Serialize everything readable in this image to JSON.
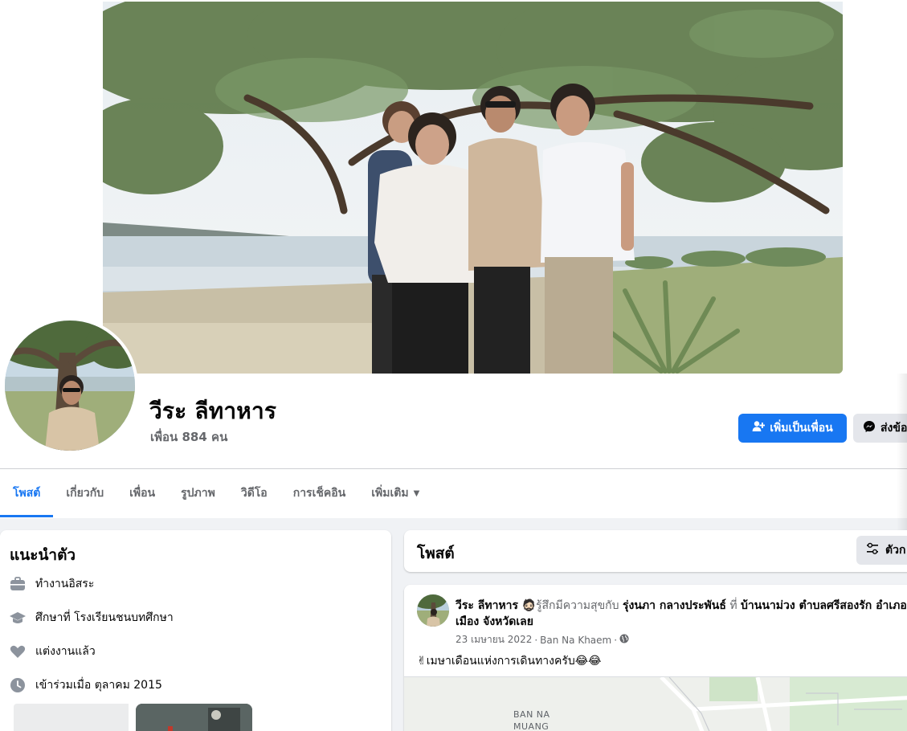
{
  "profile": {
    "name": "วีระ ลีทาหาร",
    "friends_label": "เพื่อน 884 คน"
  },
  "actions": {
    "add_friend_label": "เพิ่มเป็นเพื่อน",
    "message_label": "ส่งข้อ"
  },
  "tabs": [
    {
      "label": "โพสต์",
      "active": true
    },
    {
      "label": "เกี่ยวกับ",
      "active": false
    },
    {
      "label": "เพื่อน",
      "active": false
    },
    {
      "label": "รูปภาพ",
      "active": false
    },
    {
      "label": "วิดีโอ",
      "active": false
    },
    {
      "label": "การเช็คอิน",
      "active": false
    },
    {
      "label": "เพิ่มเติม",
      "active": false
    }
  ],
  "intro": {
    "title": "แนะนำตัว",
    "items": [
      {
        "icon": "briefcase-icon",
        "text": "ทำงานอิสระ"
      },
      {
        "icon": "graduation-cap-icon",
        "text": "ศึกษาที่ โรงเรียนชนบทศึกษา"
      },
      {
        "icon": "heart-icon",
        "text": "แต่งงานแล้ว"
      },
      {
        "icon": "clock-icon",
        "text": "เข้าร่วมเมื่อ ตุลาคม 2015"
      }
    ]
  },
  "posts": {
    "title": "โพสต์",
    "filter_label": "ตัวก"
  },
  "post": {
    "author": "วีระ ลีทาหาร",
    "feeling_text": "รู้สึกมีความสุขกับ",
    "tagged": "รุ่งนภา กลางประพันธ์",
    "at_word": "ที่",
    "place": "บ้านนาม่วง ตำบลศรีสองรัก อำเภอเมือง จังหวัดเลย",
    "date": "23 เมษายน 2022",
    "location": "Ban Na Khaem",
    "text": "✌เมษาเดือนแห่งการเดินทางครับ😂😂",
    "map_label_line1": "BAN NA",
    "map_label_line2": "MUANG"
  },
  "colors": {
    "accent": "#1877f2",
    "secondary_button": "#e4e6eb",
    "page_bg": "#f0f2f5",
    "muted_text": "#65676b"
  }
}
